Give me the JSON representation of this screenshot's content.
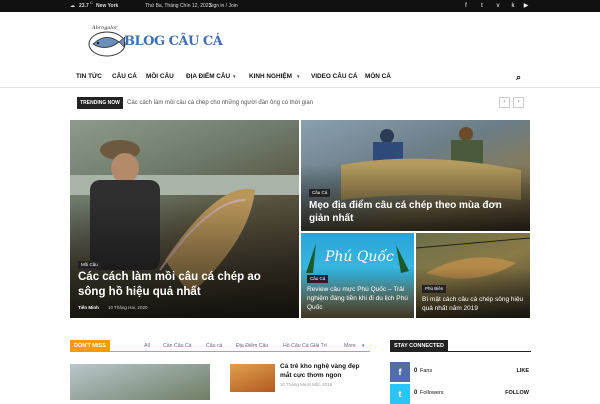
{
  "topbar": {
    "temp": "23.7",
    "temp_unit": "C",
    "city": "New York",
    "date": "Thứ Ba, Tháng Chín 12, 2023",
    "sign": "Sign in / Join"
  },
  "social_icons": [
    "facebook-icon",
    "twitter-icon",
    "vimeo-icon",
    "vk-icon",
    "youtube-icon"
  ],
  "logo": {
    "text": "BLOG CÂU CÁ",
    "script_text": "Abrogalor"
  },
  "nav": {
    "items": [
      {
        "label": "TIN TỨC"
      },
      {
        "label": "CÂU CÁ"
      },
      {
        "label": "MỒI CÂU"
      },
      {
        "label": "ĐỊA ĐIỂM CÂU",
        "dropdown": true
      },
      {
        "label": "KINH NGHIỆM",
        "dropdown": true
      },
      {
        "label": "VIDEO CÂU CÁ"
      },
      {
        "label": "MÓN CÁ"
      }
    ]
  },
  "trending": {
    "label": "TRENDING NOW",
    "text": "Các cách làm mồi câu cá chép cho những người đàn ông có thời gian"
  },
  "featured": [
    {
      "category": "Mồi Câu",
      "title": "Các cách làm mồi câu cá chép ao sông hồ hiệu quả nhất",
      "author": "Tiến Minh",
      "date": "10 Tháng Hai, 2020"
    },
    {
      "category": "Câu Cá",
      "title": "Mẹo địa điểm câu cá chép theo mùa đơn giản nhất"
    },
    {
      "category": "Câu Cá",
      "title": "Review câu mực Phú Quốc – Trải nghiệm đáng tiền khi đi du lịch Phú Quốc",
      "overlay_text": "Phú Quốc"
    },
    {
      "category": "Phù Biên",
      "title": "Bí mật cách câu cá chép sông hiệu quả nhất năm 2019"
    }
  ],
  "dont_miss": {
    "label": "DON'T MISS",
    "filters": [
      "All",
      "Cần Câu Cá",
      "Câu cá",
      "Địa Điểm Câu",
      "Hồ Câu Cá Giải Trí",
      "More"
    ],
    "post_title": "Cá trê kho nghệ vàng đẹp mắt cực thơm ngon",
    "post_date": "10 Tháng Mười Một, 2019"
  },
  "stay": {
    "label": "STAY CONNECTED",
    "rows": [
      {
        "count": "0",
        "unit": "Fans",
        "action": "LIKE",
        "icon": "facebook-icon",
        "color": "#516eab"
      },
      {
        "count": "0",
        "unit": "Followers",
        "action": "FOLLOW",
        "icon": "twitter-icon",
        "color": "#29c5f6"
      }
    ]
  },
  "colors": {
    "accent": "#ff9900",
    "dark": "#222222"
  }
}
